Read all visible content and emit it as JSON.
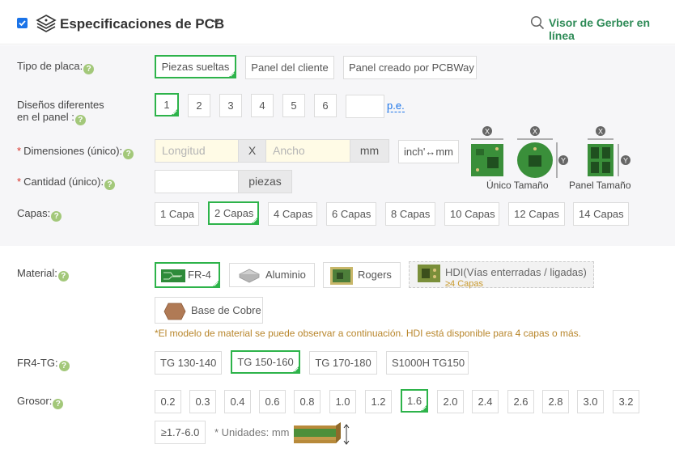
{
  "header": {
    "title": "Especificaciones de PCB",
    "gerber_link": "Visor de Gerber en línea"
  },
  "board_type": {
    "label": "Tipo de placa:",
    "options": [
      "Piezas sueltas",
      "Panel del cliente",
      "Panel creado por PCBWay"
    ],
    "selected": "Piezas sueltas"
  },
  "designs": {
    "label_line1": "Diseños diferentes",
    "label_line2": "en el panel :",
    "options": [
      "1",
      "2",
      "3",
      "4",
      "5",
      "6"
    ],
    "selected": "1",
    "custom_value": "",
    "example_link": "p.e."
  },
  "dimensions": {
    "required_mark": "*",
    "label": "Dimensiones (único):",
    "length_placeholder": "Longitud",
    "separator": "X",
    "width_placeholder": "Ancho",
    "unit": "mm",
    "convert_button": "inch'↔mm"
  },
  "quantity": {
    "required_mark": "*",
    "label": "Cantidad (único):",
    "value": "",
    "unit": "piezas"
  },
  "diagrams": {
    "single_caption": "Único Tamaño",
    "panel_caption": "Panel Tamaño",
    "axis_x": "X",
    "axis_y": "Y"
  },
  "layers": {
    "label": "Capas:",
    "options": [
      "1 Capa",
      "2 Capas",
      "4 Capas",
      "6 Capas",
      "8 Capas",
      "10 Capas",
      "12 Capas",
      "14 Capas"
    ],
    "selected": "2 Capas"
  },
  "material": {
    "label": "Material:",
    "options": [
      "FR-4",
      "Aluminio",
      "Rogers",
      "HDI(Vías enterradas / ligadas)",
      "Base de Cobre"
    ],
    "selected": "FR-4",
    "hdi_note": "≥4 Capas",
    "note": "*El modelo de material se puede observar a continuación. HDI está disponible para 4 capas o más."
  },
  "tg": {
    "label": "FR4-TG:",
    "options": [
      "TG 130-140",
      "TG 150-160",
      "TG 170-180",
      "S1000H TG150"
    ],
    "selected": "TG 150-160"
  },
  "thickness": {
    "label": "Grosor:",
    "options": [
      "0.2",
      "0.3",
      "0.4",
      "0.6",
      "0.8",
      "1.0",
      "1.2",
      "1.6",
      "2.0",
      "2.4",
      "2.6",
      "2.8",
      "3.0",
      "3.2",
      "≥1.7-6.0"
    ],
    "selected": "1.6",
    "units_note": "* Unidades: mm"
  },
  "colors": {
    "accent_green": "#2db34a",
    "link_green": "#2e8b57",
    "link_blue": "#1a73e8",
    "help_green": "#a3c87a",
    "required_red": "#d9342b",
    "note_gold": "#b8862b"
  }
}
